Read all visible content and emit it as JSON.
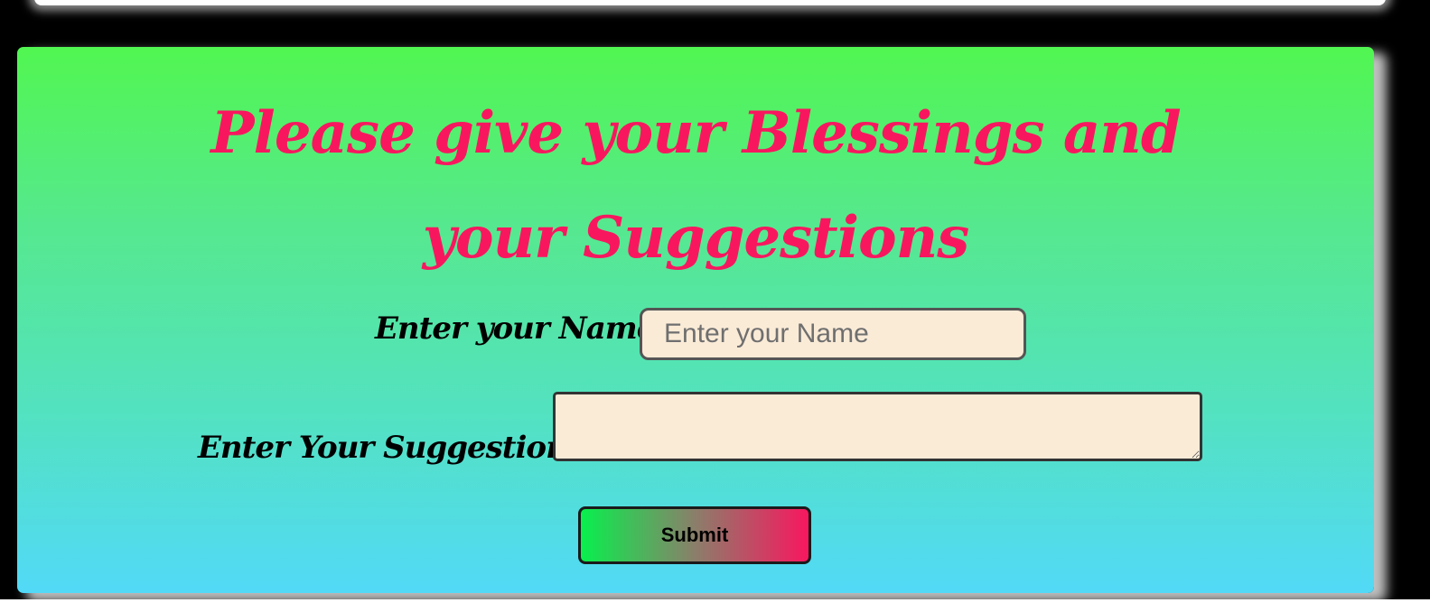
{
  "form": {
    "title": "Please give your Blessings and your Suggestions",
    "name_label": "Enter your Name:",
    "name_placeholder": "Enter your Name",
    "name_value": "",
    "suggestions_label": "Enter Your Suggestions:",
    "suggestions_value": "",
    "submit_label": "Submit"
  },
  "colors": {
    "title": "#f8175f",
    "card_gradient_top": "#51f651",
    "card_gradient_bottom": "#52d9f7",
    "input_background": "#faebd7",
    "button_gradient_start": "#07f04d",
    "button_gradient_end": "#f8175f",
    "page_background": "#000000"
  }
}
